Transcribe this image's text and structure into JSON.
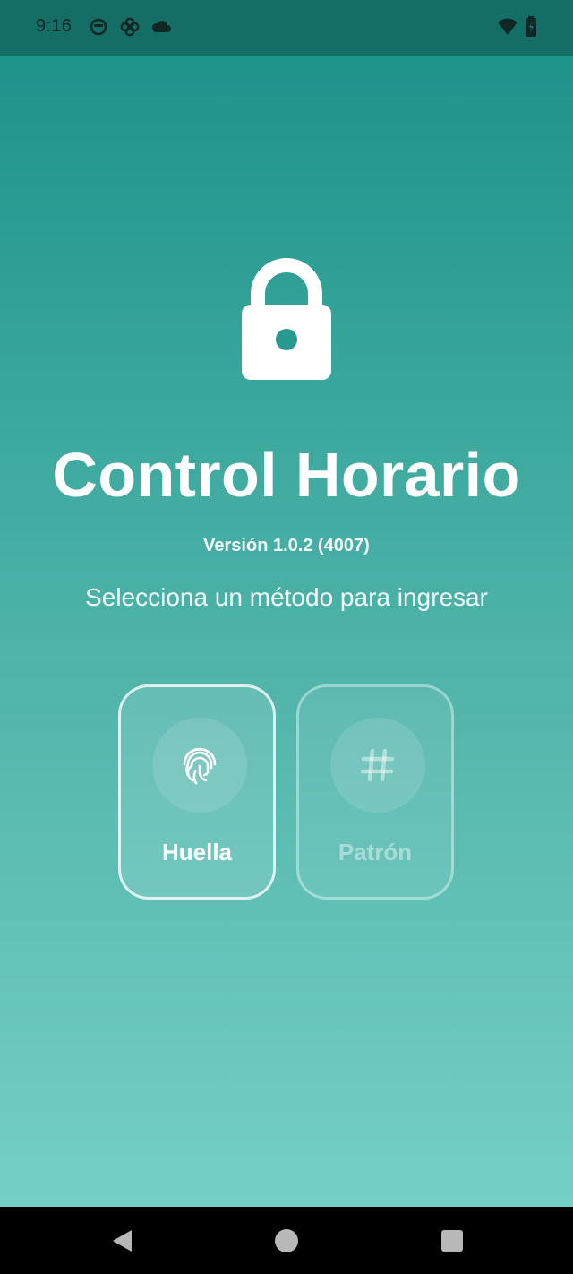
{
  "status_bar": {
    "time": "9:16",
    "left_icons": [
      "face-status-icon",
      "pinwheel-status-icon",
      "cloud-status-icon"
    ],
    "right_icons": [
      "wifi-icon",
      "battery-icon"
    ]
  },
  "main": {
    "icon": "lock-icon",
    "title": "Control Horario",
    "version": "Versión 1.0.2 (4007)",
    "subtitle": "Selecciona un método para ingresar",
    "methods": [
      {
        "label": "Huella",
        "icon": "fingerprint-icon",
        "selected": true
      },
      {
        "label": "Patrón",
        "icon": "hash-icon",
        "selected": false
      }
    ]
  },
  "nav_bar": {
    "buttons": [
      "back-icon",
      "home-icon",
      "recents-icon"
    ]
  },
  "colors": {
    "status_bar": "#156e65",
    "gradient_top": "#1e938a",
    "gradient_bottom": "#74d0c7",
    "nav_bar": "#000000",
    "text": "#ffffff"
  }
}
